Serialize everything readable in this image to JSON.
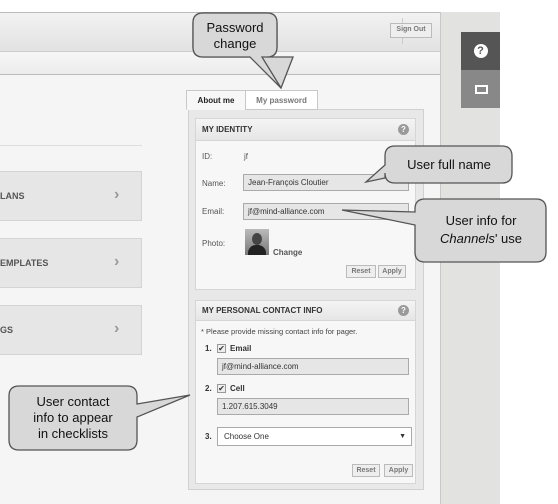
{
  "header": {
    "sign_out": "Sign Out"
  },
  "side_tabs": [
    {
      "icon": "help-icon",
      "glyph": "?"
    },
    {
      "icon": "channels-icon",
      "glyph": "▭"
    }
  ],
  "nav": [
    {
      "label": "LANS"
    },
    {
      "label": "EMPLATES"
    },
    {
      "label": "GS"
    }
  ],
  "nav_chevron": "›",
  "tabs": [
    {
      "label": "About me",
      "active": true
    },
    {
      "label": "My password",
      "active": false
    }
  ],
  "identity": {
    "title": "MY IDENTITY",
    "help": "?",
    "id_label": "ID:",
    "id_value": "jf",
    "name_label": "Name:",
    "name_value": "Jean-François Cloutier",
    "email_label": "Email:",
    "email_value": "jf@mind-alliance.com",
    "photo_label": "Photo:",
    "photo_change": "Change",
    "reset": "Reset",
    "apply": "Apply"
  },
  "contact": {
    "title": "MY PERSONAL CONTACT INFO",
    "help": "?",
    "note": "* Please provide missing contact info for pager.",
    "items": [
      {
        "num": "1.",
        "checked": true,
        "label": "Email",
        "value": "jf@mind-alliance.com"
      },
      {
        "num": "2.",
        "checked": true,
        "label": "Cell",
        "value": "1.207.615.3049"
      }
    ],
    "select_num": "3.",
    "select_value": "Choose One",
    "reset": "Reset",
    "apply": "Apply"
  },
  "callouts": {
    "password": [
      "Password",
      "change"
    ],
    "full_name": [
      "User full name"
    ],
    "channels": [
      "User info for",
      "Channels",
      "' use"
    ],
    "contact": [
      "User contact",
      "info to appear",
      "in checklists"
    ]
  },
  "colors": {
    "dark_tab": "#555555",
    "mid_tab": "#888888",
    "panel_bg": "#e8e8e8"
  }
}
